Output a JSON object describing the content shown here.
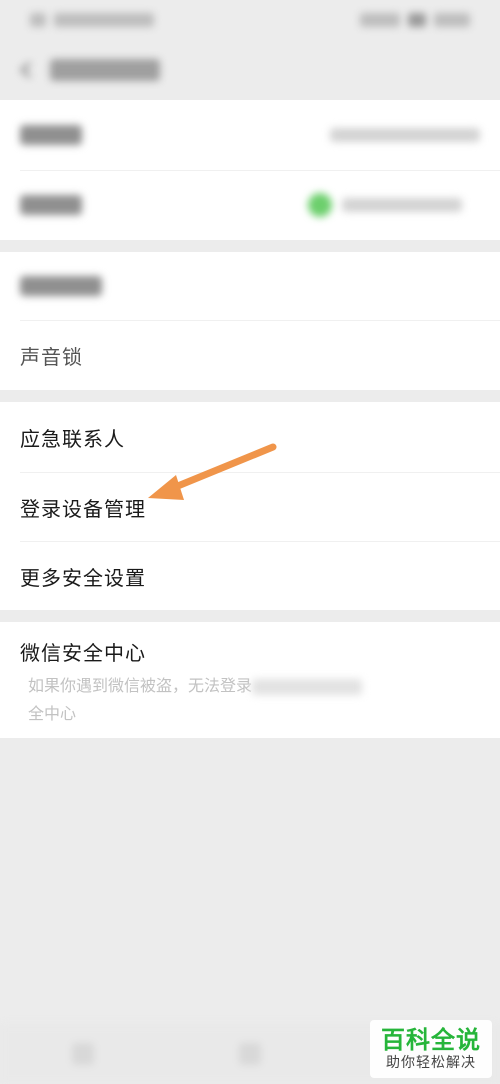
{
  "settings": {
    "voice_lock": "声音锁",
    "emergency_contact": "应急联系人",
    "login_device_management": "登录设备管理",
    "more_security_settings": "更多安全设置",
    "security_center": "微信安全中心",
    "security_center_desc_start": "如果你遇到微信被盗，无法登录",
    "security_center_desc_end": "全中心"
  },
  "watermark": {
    "title": "百科全说",
    "subtitle": "助你轻松解决"
  },
  "colors": {
    "arrow": "#f0954a",
    "watermark_green": "#26b53a",
    "background": "#ececec"
  }
}
